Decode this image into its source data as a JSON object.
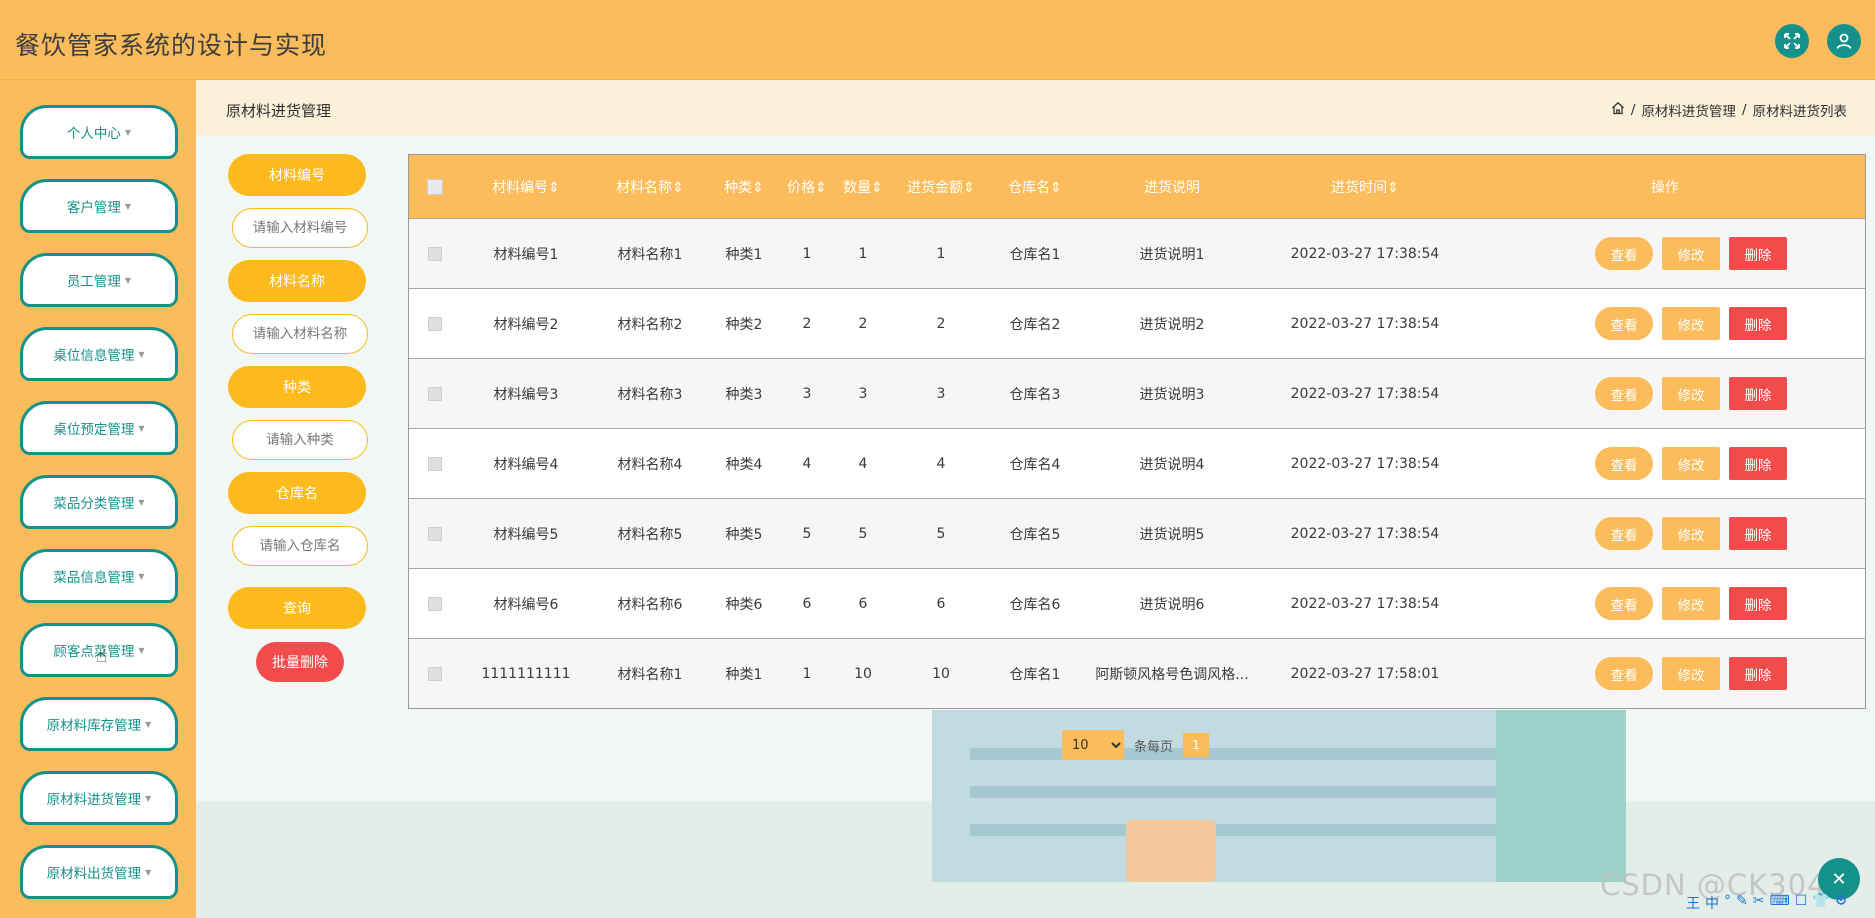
{
  "app": {
    "title": "餐饮管家系统的设计与实现"
  },
  "sidebar": {
    "items": [
      {
        "label": "个人中心"
      },
      {
        "label": "客户管理"
      },
      {
        "label": "员工管理"
      },
      {
        "label": "桌位信息管理"
      },
      {
        "label": "桌位预定管理"
      },
      {
        "label": "菜品分类管理"
      },
      {
        "label": "菜品信息管理"
      },
      {
        "label": "顾客点菜管理"
      },
      {
        "label": "原材料库存管理"
      },
      {
        "label": "原材料进货管理"
      },
      {
        "label": "原材料出货管理"
      }
    ]
  },
  "header": {
    "page_title": "原材料进货管理",
    "breadcrumb": [
      "原材料进货管理",
      "原材料进货列表"
    ]
  },
  "filters": {
    "material_code_label": "材料编号",
    "material_code_placeholder": "请输入材料编号",
    "material_name_label": "材料名称",
    "material_name_placeholder": "请输入材料名称",
    "category_label": "种类",
    "category_placeholder": "请输入种类",
    "warehouse_label": "仓库名",
    "warehouse_placeholder": "请输入仓库名",
    "query_button": "查询",
    "batch_delete_button": "批量删除"
  },
  "table": {
    "headers": [
      "材料编号",
      "材料名称",
      "种类",
      "价格",
      "数量",
      "进货金额",
      "仓库名",
      "进货说明",
      "进货时间",
      "操作"
    ],
    "action_labels": {
      "view": "查看",
      "edit": "修改",
      "delete": "删除"
    },
    "rows": [
      [
        "材料编号1",
        "材料名称1",
        "种类1",
        "1",
        "1",
        "1",
        "仓库名1",
        "进货说明1",
        "2022-03-27 17:38:54"
      ],
      [
        "材料编号2",
        "材料名称2",
        "种类2",
        "2",
        "2",
        "2",
        "仓库名2",
        "进货说明2",
        "2022-03-27 17:38:54"
      ],
      [
        "材料编号3",
        "材料名称3",
        "种类3",
        "3",
        "3",
        "3",
        "仓库名3",
        "进货说明3",
        "2022-03-27 17:38:54"
      ],
      [
        "材料编号4",
        "材料名称4",
        "种类4",
        "4",
        "4",
        "4",
        "仓库名4",
        "进货说明4",
        "2022-03-27 17:38:54"
      ],
      [
        "材料编号5",
        "材料名称5",
        "种类5",
        "5",
        "5",
        "5",
        "仓库名5",
        "进货说明5",
        "2022-03-27 17:38:54"
      ],
      [
        "材料编号6",
        "材料名称6",
        "种类6",
        "6",
        "6",
        "6",
        "仓库名6",
        "进货说明6",
        "2022-03-27 17:38:54"
      ],
      [
        "1111111111",
        "材料名称1",
        "种类1",
        "1",
        "10",
        "10",
        "仓库名1",
        "阿斯顿风格号色调风格...",
        "2022-03-27 17:58:01"
      ]
    ]
  },
  "pagination": {
    "page_size": "10",
    "per_page_label": "条每页",
    "current_page": "1"
  },
  "watermark": {
    "text": "CSDN @CK3043"
  },
  "ime": {
    "glyphs": [
      "王",
      "中",
      "°",
      "✎",
      "✂",
      "⌨",
      "☐",
      "👕",
      "⚙"
    ]
  },
  "colors": {
    "primary": "#fcbc5b",
    "accent": "#14918a",
    "danger": "#f14b4b",
    "label_fill": "#fcba1d"
  }
}
